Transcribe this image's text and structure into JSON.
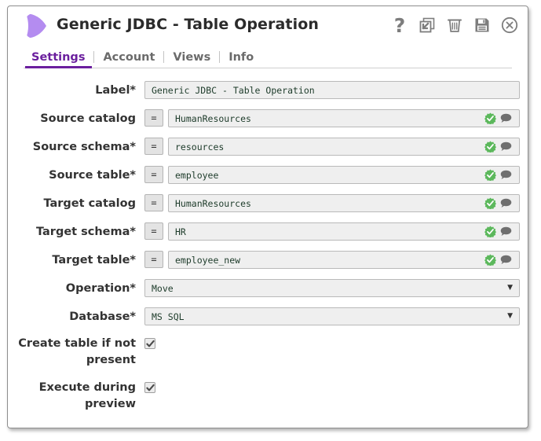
{
  "window": {
    "title": "Generic JDBC - Table Operation",
    "logo_icon": "purple-crescent-logo",
    "titlebar_icons": [
      {
        "name": "help-icon",
        "glyph": "?"
      },
      {
        "name": "restore-window-icon",
        "glyph": "restore"
      },
      {
        "name": "delete-icon",
        "glyph": "trash"
      },
      {
        "name": "save-icon",
        "glyph": "floppy-disk"
      },
      {
        "name": "close-icon",
        "glyph": "circle-x"
      }
    ]
  },
  "tabs": [
    {
      "label": "Settings",
      "active": true
    },
    {
      "label": "Account",
      "active": false
    },
    {
      "label": "Views",
      "active": false
    },
    {
      "label": "Info",
      "active": false
    }
  ],
  "form": {
    "rows": [
      {
        "type": "text",
        "name": "label",
        "label": "Label*",
        "has_eq": false,
        "eq_label": "=",
        "value": "Generic JDBC - Table Operation",
        "has_status_icons": false
      },
      {
        "type": "text",
        "name": "source-catalog",
        "label": "Source catalog",
        "has_eq": true,
        "eq_label": "=",
        "value": "HumanResources",
        "has_status_icons": true
      },
      {
        "type": "text",
        "name": "source-schema",
        "label": "Source schema*",
        "has_eq": true,
        "eq_label": "=",
        "value": "resources",
        "has_status_icons": true
      },
      {
        "type": "text",
        "name": "source-table",
        "label": "Source table*",
        "has_eq": true,
        "eq_label": "=",
        "value": "employee",
        "has_status_icons": true
      },
      {
        "type": "text",
        "name": "target-catalog",
        "label": "Target catalog",
        "has_eq": true,
        "eq_label": "=",
        "value": "HumanResources",
        "has_status_icons": true
      },
      {
        "type": "text",
        "name": "target-schema",
        "label": "Target schema*",
        "has_eq": true,
        "eq_label": "=",
        "value": "HR",
        "has_status_icons": true
      },
      {
        "type": "text",
        "name": "target-table",
        "label": "Target table*",
        "has_eq": true,
        "eq_label": "=",
        "value": "employee_new",
        "has_status_icons": true
      },
      {
        "type": "select",
        "name": "operation",
        "label": "Operation*",
        "value": "Move",
        "caret": "▼"
      },
      {
        "type": "select",
        "name": "database",
        "label": "Database*",
        "value": "MS SQL",
        "caret": "▼"
      },
      {
        "type": "checkbox",
        "name": "create-table-if-not-present",
        "label": "Create table if not present",
        "checked": true
      },
      {
        "type": "checkbox",
        "name": "execute-during-preview",
        "label": "Execute during preview",
        "checked": true
      }
    ]
  },
  "colors": {
    "accent": "#6b1f9e",
    "logo": "#b48cf0",
    "status_ok": "#5cb85c",
    "bubble": "#6f6f6f",
    "field_bg": "#efefef",
    "value_text": "#1d3b2a"
  }
}
